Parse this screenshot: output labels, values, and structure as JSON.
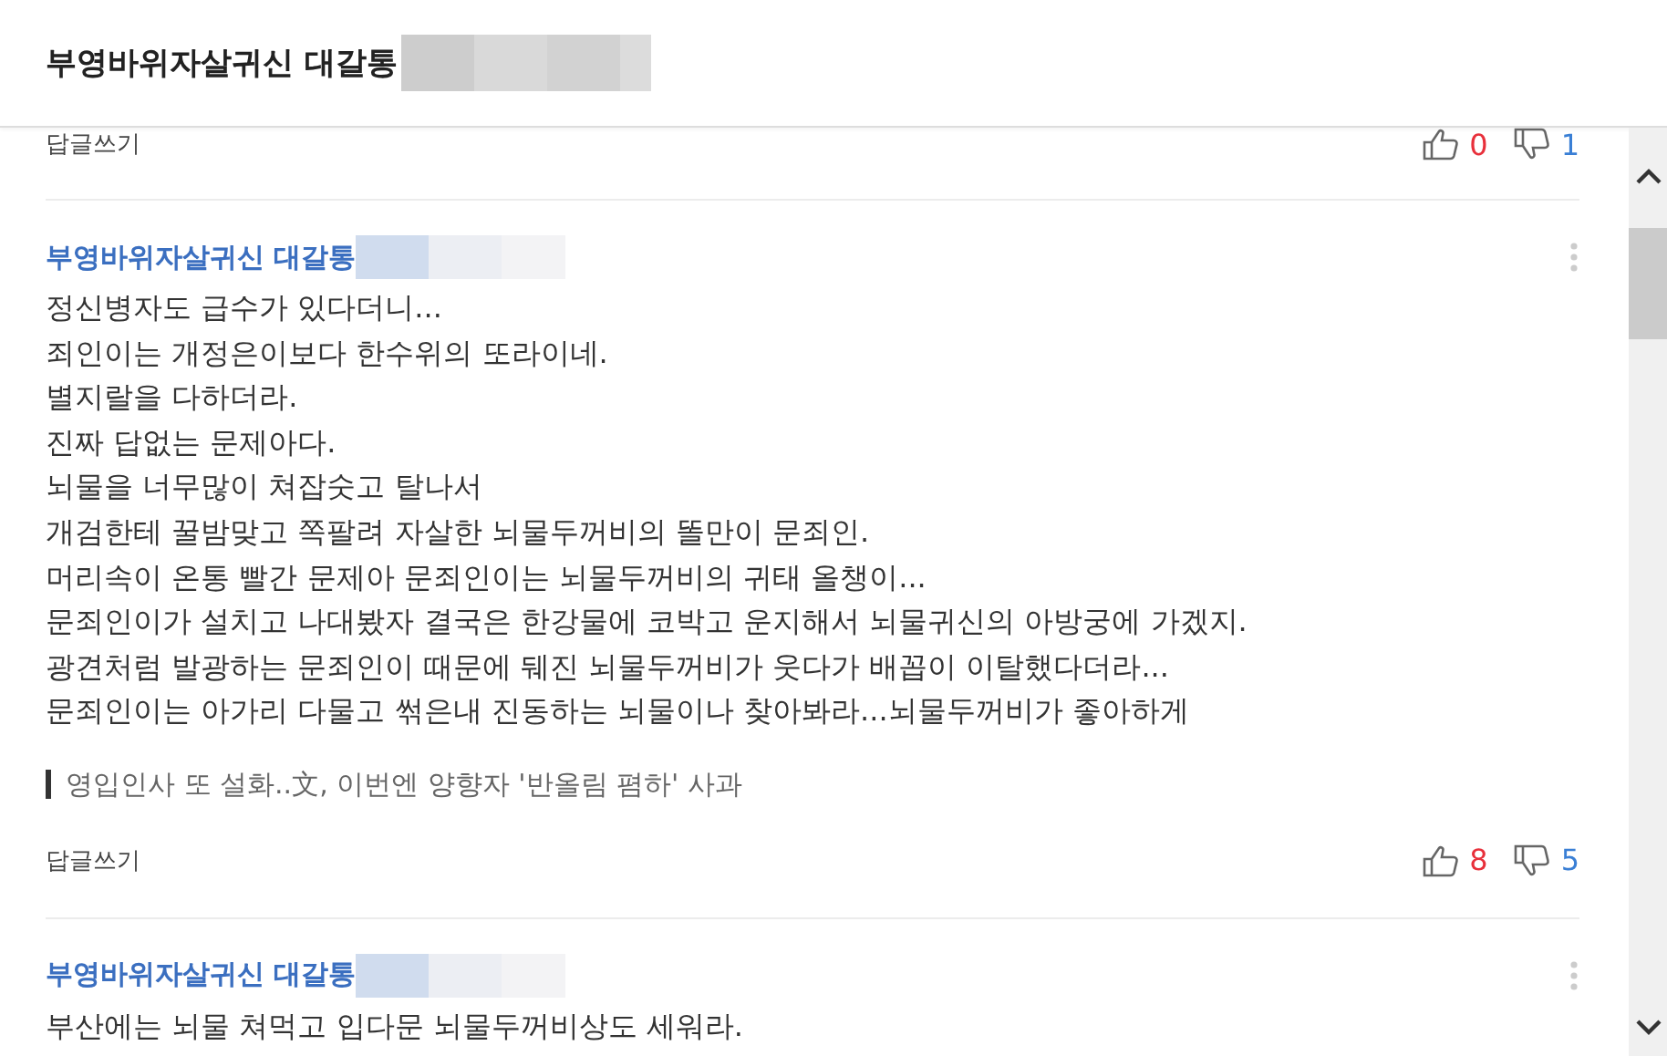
{
  "header": {
    "title": "부영바위자살귀신 대갈통"
  },
  "previous_footer": {
    "reply": "답글쓰기",
    "likes": "0",
    "dislikes": "1"
  },
  "comments": [
    {
      "author": "부영바위자살귀신 대갈통",
      "lines": [
        "정신병자도 급수가 있다더니...",
        "죄인이는 개정은이보다 한수위의 또라이네.",
        "별지랄을 다하더라.",
        "진짜 답없는 문제아다.",
        "뇌물을 너무많이 쳐잡숫고 탈나서",
        "개검한테 꿀밤맞고 쪽팔려 자살한 뇌물두꺼비의 똘만이 문죄인.",
        "머리속이 온통 빨간 문제아 문죄인이는 뇌물두꺼비의 귀태 올챙이...",
        "문죄인이가 설치고 나대봤자 결국은 한강물에 코박고 운지해서 뇌물귀신의 아방궁에 가겠지.",
        "광견처럼 발광하는 문죄인이 때문에 뒈진 뇌물두꺼비가 웃다가 배꼽이 이탈했다더라...",
        "문죄인이는 아가리 다물고 썪은내 진동하는 뇌물이나 찾아봐라...뇌물두꺼비가 좋아하게"
      ],
      "quote": "영입인사 또 설화..文, 이번엔 양향자 '반올림 폄하' 사과",
      "reply": "답글쓰기",
      "likes": "8",
      "dislikes": "5"
    },
    {
      "author": "부영바위자살귀신 대갈통",
      "lines": [
        "부산에는 뇌물 쳐먹고 입다문 뇌물두꺼비상도 세워라."
      ]
    }
  ]
}
